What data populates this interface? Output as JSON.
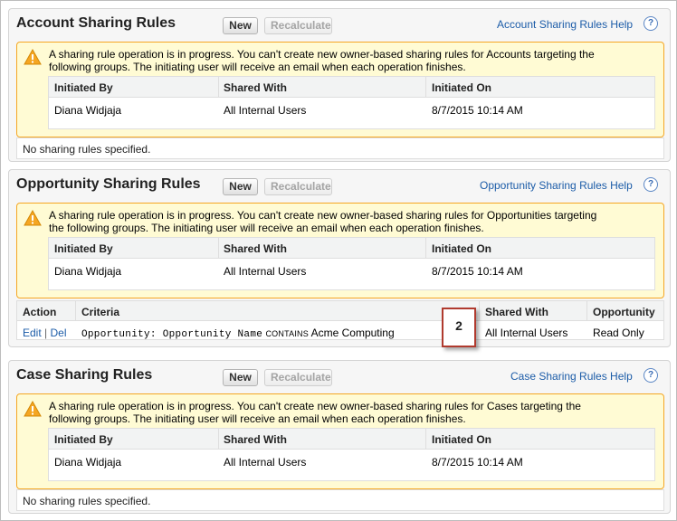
{
  "colors": {
    "link": "#1c5ca8",
    "warning_border": "#f5a623",
    "warning_bg": "#fffbd4",
    "callout_border": "#b03a2e"
  },
  "buttons": {
    "new": "New",
    "recalculate": "Recalculate"
  },
  "columns": {
    "initiated_by": "Initiated By",
    "shared_with": "Shared With",
    "initiated_on": "Initiated On"
  },
  "operation": {
    "initiated_by": "Diana Widjaja",
    "shared_with": "All Internal Users",
    "initiated_on": "8/7/2015 10:14 AM"
  },
  "empty_text": "No sharing rules specified.",
  "help_icon_glyph": "?",
  "sections": [
    {
      "title": "Account Sharing Rules",
      "help": "Account Sharing Rules Help",
      "warning_line1": "A sharing rule operation is in progress. You can't create new owner-based sharing rules for Accounts targeting the",
      "warning_line2": "following groups. The initiating user will receive an email when each operation finishes."
    },
    {
      "title": "Opportunity Sharing Rules",
      "help": "Opportunity Sharing Rules Help",
      "warning_line1": "A sharing rule operation is in progress. You can't create new owner-based sharing rules for Opportunities targeting",
      "warning_line2": "the following groups. The initiating user will receive an email when each operation finishes."
    },
    {
      "title": "Case Sharing Rules",
      "help": "Case Sharing Rules Help",
      "warning_line1": "A sharing rule operation is in progress. You can't create new owner-based sharing rules for Cases targeting the",
      "warning_line2": "following groups. The initiating user will receive an email when each operation finishes."
    }
  ],
  "opportunity_rules": {
    "headers": {
      "action": "Action",
      "criteria": "Criteria",
      "shared_with": "Shared With",
      "access": "Opportunity"
    },
    "row": {
      "edit": "Edit",
      "separator": "|",
      "del": "Del",
      "criteria_field": "Opportunity: Opportunity Name",
      "criteria_op": "CONTAINS",
      "criteria_value": "Acme Computing",
      "shared_with": "All Internal Users",
      "access": "Read Only"
    }
  },
  "callout": "2"
}
